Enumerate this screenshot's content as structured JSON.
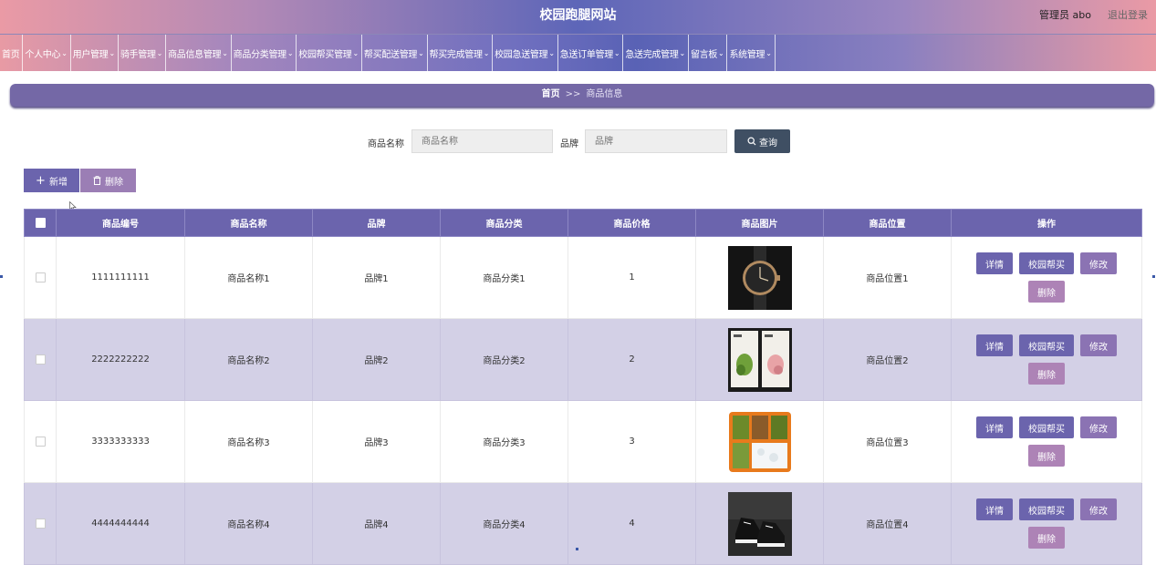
{
  "header": {
    "site_title": "校园跑腿网站",
    "user_text": "管理员 abo",
    "logout_label": "退出登录"
  },
  "nav": {
    "items": [
      {
        "label": "首页",
        "has_menu": false
      },
      {
        "label": "个人中心",
        "has_menu": true
      },
      {
        "label": "用户管理",
        "has_menu": true
      },
      {
        "label": "骑手管理",
        "has_menu": true
      },
      {
        "label": "商品信息管理",
        "has_menu": true
      },
      {
        "label": "商品分类管理",
        "has_menu": true
      },
      {
        "label": "校园帮买管理",
        "has_menu": true
      },
      {
        "label": "帮买配送管理",
        "has_menu": true
      },
      {
        "label": "帮买完成管理",
        "has_menu": true
      },
      {
        "label": "校园急送管理",
        "has_menu": true
      },
      {
        "label": "急送订单管理",
        "has_menu": true
      },
      {
        "label": "急送完成管理",
        "has_menu": true
      },
      {
        "label": "留言板",
        "has_menu": true
      },
      {
        "label": "系统管理",
        "has_menu": true
      }
    ]
  },
  "breadcrumb": {
    "home": "首页",
    "separator": ">>",
    "current": "商品信息"
  },
  "search": {
    "name_label": "商品名称",
    "name_placeholder": "商品名称",
    "name_value": "",
    "brand_label": "品牌",
    "brand_placeholder": "品牌",
    "brand_value": "",
    "button_label": "查询"
  },
  "actions": {
    "add_label": "新增",
    "delete_label": "删除"
  },
  "table": {
    "columns": [
      "商品编号",
      "商品名称",
      "品牌",
      "商品分类",
      "商品价格",
      "商品图片",
      "商品位置",
      "操作"
    ],
    "rows": [
      {
        "code": "1111111111",
        "name": "商品名称1",
        "brand": "品牌1",
        "category": "商品分类1",
        "price": "1",
        "image": "watch",
        "location": "商品位置1"
      },
      {
        "code": "2222222222",
        "name": "商品名称2",
        "brand": "品牌2",
        "category": "商品分类2",
        "price": "2",
        "image": "tea-packs",
        "location": "商品位置2"
      },
      {
        "code": "3333333333",
        "name": "商品名称3",
        "brand": "品牌3",
        "category": "商品分类3",
        "price": "3",
        "image": "bento-box",
        "location": "商品位置3"
      },
      {
        "code": "4444444444",
        "name": "商品名称4",
        "brand": "品牌4",
        "category": "商品分类4",
        "price": "4",
        "image": "sneakers",
        "location": "商品位置4"
      }
    ],
    "row_actions": {
      "detail": "详情",
      "buy": "校园帮买",
      "edit": "修改",
      "delete": "删除"
    }
  },
  "colors": {
    "primary": "#6b64ad",
    "secondary": "#9b7eb5",
    "search_button": "#3f4f63",
    "row_alt": "#d3d0e6"
  }
}
